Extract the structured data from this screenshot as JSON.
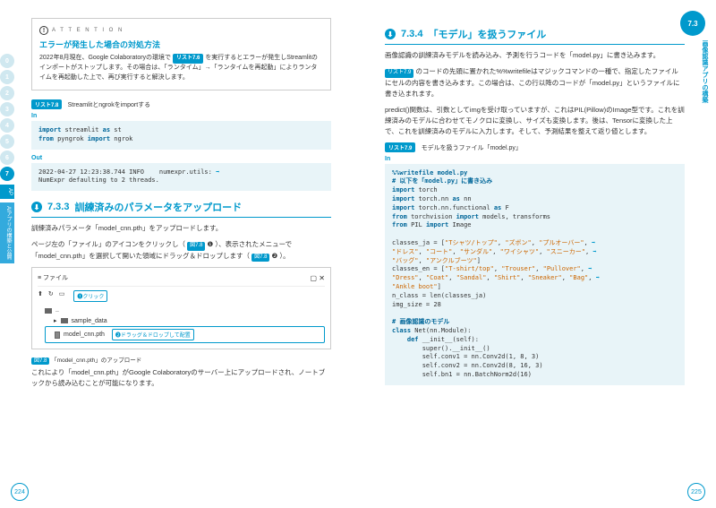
{
  "leftPage": {
    "sideNav": [
      "0",
      "1",
      "2",
      "3",
      "4",
      "5",
      "6",
      "7"
    ],
    "sideNavActive": "7",
    "sideTab1": "AP",
    "sideTab2": "AIアプリの構築と公開",
    "attention": {
      "label": "A T T E N T I O N",
      "title": "エラーが発生した場合の対処方法",
      "body1": "2022年8月現在、Google Colaboratoryの環境で",
      "ref": "リスト7.6",
      "body2": "を実行するとエラーが発生しStreamlitのインポートがストップします。その場合は、「ランタイム」→「ランタイムを再起動」によりランタイムを再起動した上で、再び実行すると解決します。"
    },
    "listTag": "リスト7.8",
    "listDesc": "Streamlitとngrokをimportする",
    "inLabel": "In",
    "code1": "import streamlit as st\nfrom pyngrok import ngrok",
    "outLabel": "Out",
    "code2": "2022-04-27 12:23:38.744 INFO    numexpr.utils: ➡\nNumExpr defaulting to 2 threads.",
    "section": {
      "num": "7.3.3",
      "title": "訓練済みのパラメータをアップロード"
    },
    "para1": "訓練済みパラメータ「model_cnn.pth」をアップロードします。",
    "para2a": "ページ左の「ファイル」のアイコンをクリックし（",
    "para2ref1": "図7.8",
    "para2num": "❶",
    "para2b": "）、表示されたメニューで「model_cnn.pth」を選択して開いた領域にドラッグ＆ドロップします（",
    "para2ref2": "図7.8",
    "para2num2": "❷",
    "para2c": "）。",
    "filePanel": {
      "title": "ファイル",
      "folder1": "..",
      "folder2": "sample_data",
      "file1": "model_cnn.pth",
      "callout1": "❶クリック",
      "callout2": "❷ドラッグ＆ドロップして配置"
    },
    "figCaption": {
      "num": "図7.8",
      "text": "「model_cnn.pth」のアップロード"
    },
    "para3": "これにより「model_cnn.pth」がGoogle Colaboratoryのサーバー上にアップロードされ、ノートブックから読み込むことが可能になります。",
    "pageNum": "224"
  },
  "rightPage": {
    "cornerBadge": "7.3",
    "sideLabel": "画像認識アプリの構築",
    "section": {
      "num": "7.3.4",
      "title": "「モデル」を扱うファイル"
    },
    "para1": "画像認識の訓練済みモデルを読み込み、予測を行うコードを「model.py」に書き込みます。",
    "para2a": "",
    "para2ref": "リスト7.9",
    "para2b": "のコードの先頭に置かれた%%writefileはマジックコマンドの一種で、指定したファイルにセルの内容を書き込みます。この場合は、この行以降のコードが「model.py」というファイルに書き込まれます。",
    "para3": "predict()関数は、引数としてimgを受け取っていますが、これはPIL(Pillow)のImage型です。これを訓練済みのモデルに合わせてモノクロに変換し、サイズも変換します。後は、Tensorに変換した上で、これを訓練済みのモデルに入力します。そして、予測結果を整えて返り値とします。",
    "listTag": "リスト7.9",
    "listDesc": "モデルを扱うファイル「model.py」",
    "inLabel": "In",
    "code": "%%writefile model.py\n# 以下を「model.py」に書き込み\nimport torch\nimport torch.nn as nn\nimport torch.nn.functional as F\nfrom torchvision import models, transforms\nfrom PIL import Image\n\nclasses_ja = [\"Tシャツ/トップ\", \"ズボン\", \"プルオーバー\", ➡\n\"ドレス\", \"コート\", \"サンダル\", \"ワイシャツ\", \"スニーカー\", ➡\n\"バッグ\", \"アンクルブーツ\"]\nclasses_en = [\"T-shirt/top\", \"Trouser\", \"Pullover\", ➡\n\"Dress\", \"Coat\", \"Sandal\", \"Shirt\", \"Sneaker\", \"Bag\", ➡\n\"Ankle boot\"]\nn_class = len(classes_ja)\nimg_size = 28\n\n# 画像認識のモデル\nclass Net(nn.Module):\n    def __init__(self):\n        super().__init__()\n        self.conv1 = nn.Conv2d(1, 8, 3)\n        self.conv2 = nn.Conv2d(8, 16, 3)\n        self.bn1 = nn.BatchNorm2d(16)",
    "pageNum": "225"
  }
}
